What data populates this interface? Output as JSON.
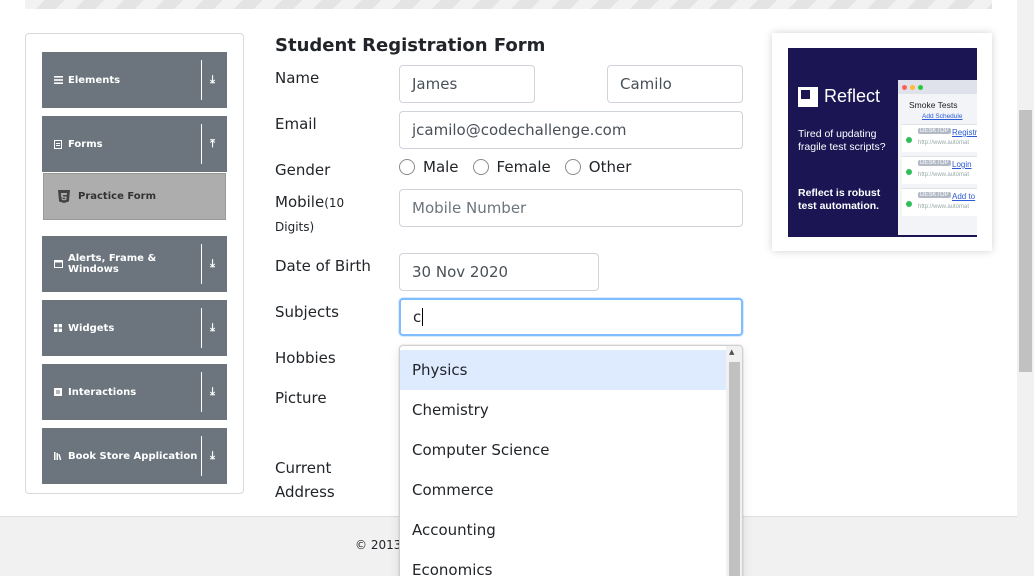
{
  "nav": {
    "groups": [
      {
        "label": "Elements",
        "icon": "list-icon",
        "chevron": "⤓"
      },
      {
        "label": "Forms",
        "icon": "form-icon",
        "chevron": "⤒"
      },
      {
        "label": "Alerts, Frame & Windows",
        "icon": "window-icon",
        "chevron": "⤓"
      },
      {
        "label": "Widgets",
        "icon": "widgets-icon",
        "chevron": "⤓"
      },
      {
        "label": "Interactions",
        "icon": "interactions-icon",
        "chevron": "⤓"
      },
      {
        "label": "Book Store Application",
        "icon": "bookstore-icon",
        "chevron": "⤓"
      }
    ],
    "active_item": {
      "label": "Practice Form",
      "icon": "html5-icon"
    },
    "colors": {
      "header_bg": "#6c757d",
      "active_item_bg": "#adadad"
    }
  },
  "form": {
    "title": "Student Registration Form",
    "labels": {
      "name": "Name",
      "email": "Email",
      "gender": "Gender",
      "mobile": "Mobile",
      "mobile_hint": "(10",
      "mobile_hint2": "Digits)",
      "dob": "Date of Birth",
      "subjects": "Subjects",
      "hobbies": "Hobbies",
      "picture": "Picture",
      "current_address_1": "Current",
      "current_address_2": "Address"
    },
    "first_name": "James",
    "last_name": "Camilo",
    "email": "jcamilo@codechallenge.com",
    "gender_options": [
      "Male",
      "Female",
      "Other"
    ],
    "mobile_placeholder": "Mobile Number",
    "dob": "30 Nov 2020",
    "subjects_value": "c"
  },
  "subjects_dropdown": {
    "options": [
      "Physics",
      "Chemistry",
      "Computer Science",
      "Commerce",
      "Accounting",
      "Economics"
    ],
    "highlighted": "Physics",
    "highlight_color": "#deebff"
  },
  "ad": {
    "brand": "Reflect",
    "text1": "Tired of updating fragile test scripts?",
    "text2": "Reflect is robust test automation.",
    "window_title": "Smoke Tests",
    "window_link": "Add Schedule",
    "rows": [
      {
        "tag": "DESKTOP",
        "link": "Registr",
        "url": "http://www.automat"
      },
      {
        "tag": "DESKTOP",
        "link": "Login",
        "url": "http://www.automat"
      },
      {
        "tag": "DESKTOP",
        "link": "Add to",
        "url": "http://www.automat"
      }
    ],
    "bg_color": "#1b1554"
  },
  "footer": {
    "text": "© 2013"
  }
}
